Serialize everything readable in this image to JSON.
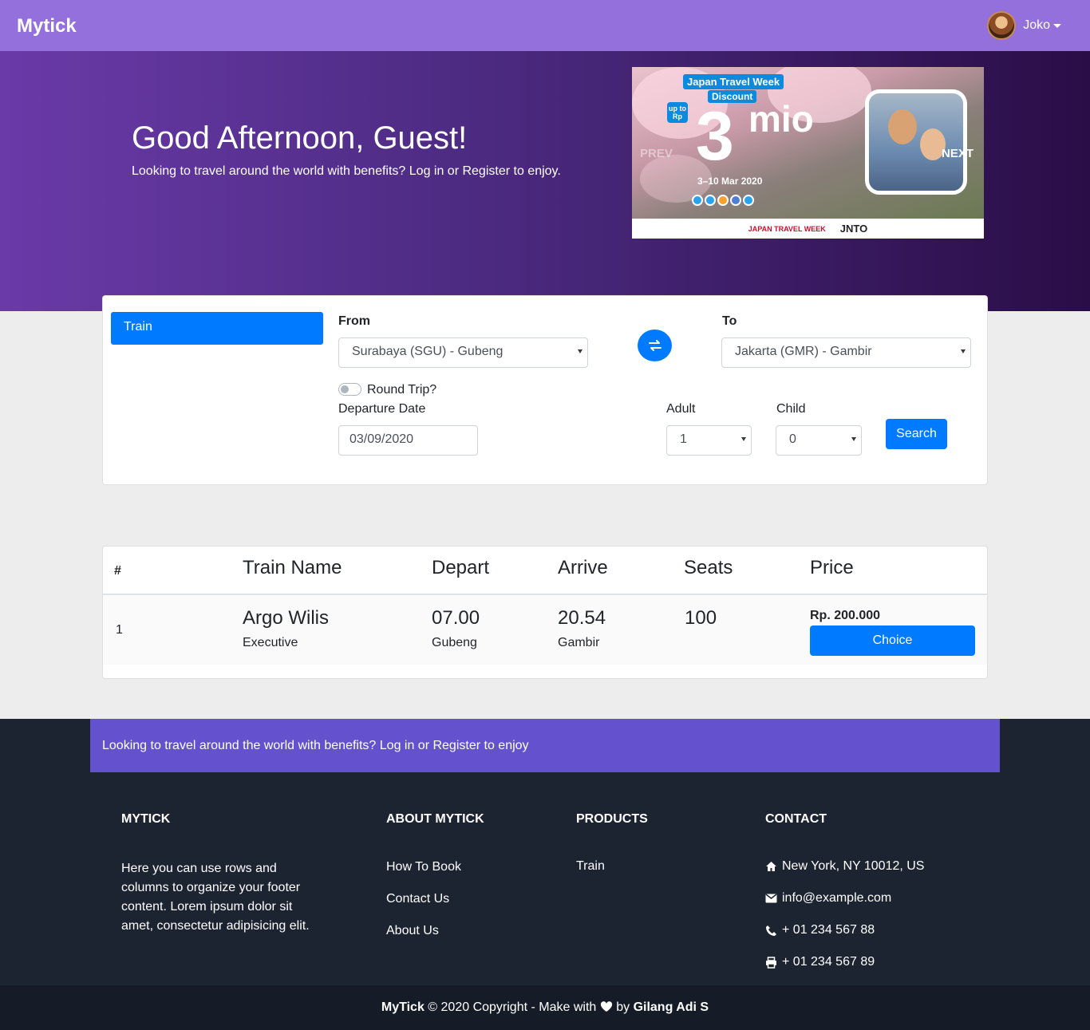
{
  "navbar": {
    "brand": "Mytick",
    "user_name": "Joko"
  },
  "hero": {
    "title": "Good Afternoon, Guest!",
    "subtitle": "Looking to travel around the world with benefits? Log in or Register to enjoy."
  },
  "carousel": {
    "promo_title": "Japan Travel Week",
    "promo_discount": "Discount",
    "promo_upto": "up to Rp",
    "promo_number": "3",
    "promo_unit": "mio",
    "promo_dates": "3–10 Mar 2020",
    "logo_left": "JAPAN TRAVEL WEEK",
    "logo_right": "JNTO",
    "prev_label": "PREV",
    "next_label": "NEXT"
  },
  "search": {
    "tab_label": "Train",
    "from_label": "From",
    "from_value": "Surabaya (SGU) - Gubeng",
    "to_label": "To",
    "to_value": "Jakarta (GMR) - Gambir",
    "round_trip_label": "Round Trip?",
    "departure_label": "Departure Date",
    "departure_value": "03/09/2020",
    "adult_label": "Adult",
    "adult_value": "1",
    "child_label": "Child",
    "child_value": "0",
    "search_button": "Search"
  },
  "results": {
    "headers": [
      "#",
      "Train Name",
      "Depart",
      "Arrive",
      "Seats",
      "Price"
    ],
    "rows": [
      {
        "index": "1",
        "train_name": "Argo Wilis",
        "train_class": "Executive",
        "depart_time": "07.00",
        "depart_station": "Gubeng",
        "arrive_time": "20.54",
        "arrive_station": "Gambir",
        "seats": "100",
        "price": "Rp. 200.000",
        "choice_button": "Choice"
      }
    ]
  },
  "footer": {
    "band_text": "Looking to travel around the world with benefits? Log in or Register to enjoy",
    "col1_title": "MYTICK",
    "col1_text": "Here you can use rows and columns to organize your footer content. Lorem ipsum dolor sit amet, consectetur adipisicing elit.",
    "col2_title": "ABOUT MYTICK",
    "col2_links": [
      "How To Book",
      "Contact Us",
      "About Us"
    ],
    "col3_title": "PRODUCTS",
    "col3_links": [
      "Train"
    ],
    "col4_title": "CONTACT",
    "contact": {
      "address": "New York, NY 10012, US",
      "email": "info@example.com",
      "phone": "+ 01 234 567 88",
      "fax": "+ 01 234 567 89"
    },
    "copyright_brand": "MyTick",
    "copyright_text": "© 2020 Copyright - Make with",
    "copyright_by": "by",
    "copyright_author": "Gilang Adi S"
  }
}
